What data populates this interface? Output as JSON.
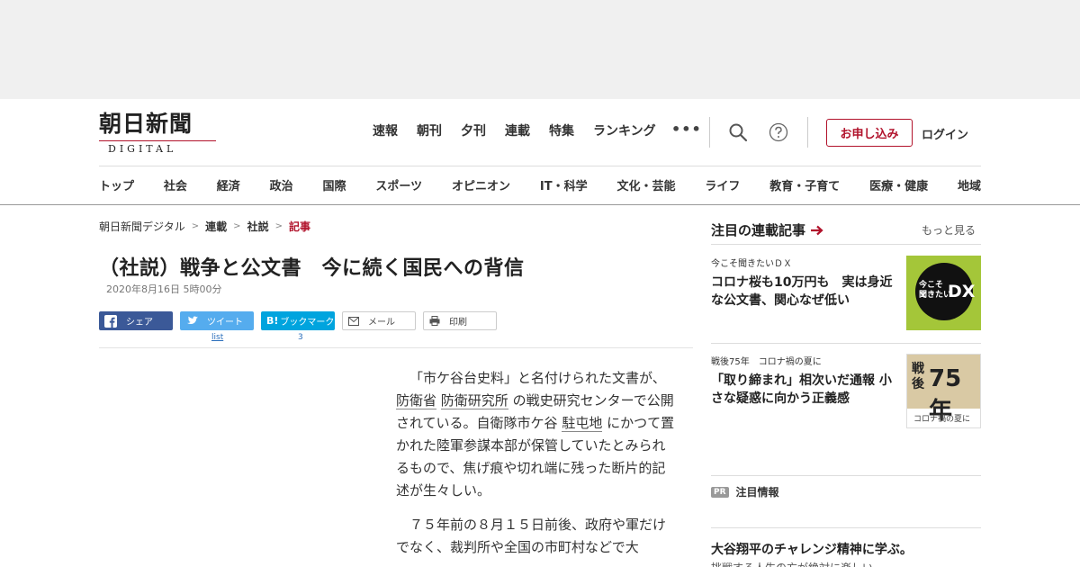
{
  "header": {
    "logo_main": "朝日新聞",
    "logo_sub": "DIGITAL",
    "top_nav": [
      "速報",
      "朝刊",
      "夕刊",
      "連載",
      "特集",
      "ランキング"
    ],
    "more_label": "•••",
    "subscribe_label": "お申し込み",
    "login_label": "ログイン",
    "categories": [
      "トップ",
      "社会",
      "経済",
      "政治",
      "国際",
      "スポーツ",
      "オピニオン",
      "IT・科学",
      "文化・芸能",
      "ライフ",
      "教育・子育て",
      "医療・健康",
      "地域"
    ]
  },
  "breadcrumb": {
    "items": [
      "朝日新聞デジタル",
      "連載",
      "社説"
    ],
    "current": "記事",
    "separator": ">"
  },
  "article": {
    "title": "（社説）戦争と公文書　今に続く国民への背信",
    "date": "2020年8月16日 5時00分",
    "share": {
      "facebook": "シェア",
      "twitter": "ツイート",
      "hatena_mark": "B!",
      "hatena": "ブックマーク",
      "mail": "メール",
      "print": "印刷",
      "twitter_count": "list",
      "hatena_count": "3"
    },
    "p1_a": "「市ケ谷台史料」と名付けられた文書が、",
    "p1_link1": "防衛省",
    "p1_link2": "防衛研究所",
    "p1_b": "の戦史研究センターで公開されている。自衛隊市ケ谷",
    "p1_link3": "駐屯地",
    "p1_c": "にかつて置かれた陸軍参謀本部が保管していたとみられるもので、焦げ痕や切れ端に残った断片的記述が生々しい。",
    "p2": "７５年前の８月１５日前後、政府や軍だけでなく、裁判所や全国の市町村などで大"
  },
  "sidebar": {
    "heading": "注目の連載記事",
    "more": "もっと見る",
    "cards": [
      {
        "kicker": "今こそ聞きたいＤＸ",
        "headline": "コロナ桜も10万円も　実は身近な公文書、関心なぜ低い",
        "thumb_text1": "今こそ\n聞きたい",
        "thumb_text2": "DX"
      },
      {
        "kicker": "戦後75年　コロナ禍の夏に",
        "headline": "「取り締まれ」相次いだ通報 小さな疑惑に向かう正義感",
        "thumb_text1": "戦\n後",
        "thumb_text2": "75年",
        "thumb_text3": "コロナ禍の夏に"
      }
    ],
    "pr_badge": "PR",
    "pr_label": "注目情報",
    "pr_headline": "大谷翔平のチャレンジ精神に学ぶ。",
    "pr_sub": "挑戦する人生の方が絶対に楽しい"
  },
  "colors": {
    "brand_red": "#b1122b",
    "facebook": "#3b5998",
    "twitter": "#55acee",
    "hatena": "#00a4de"
  }
}
